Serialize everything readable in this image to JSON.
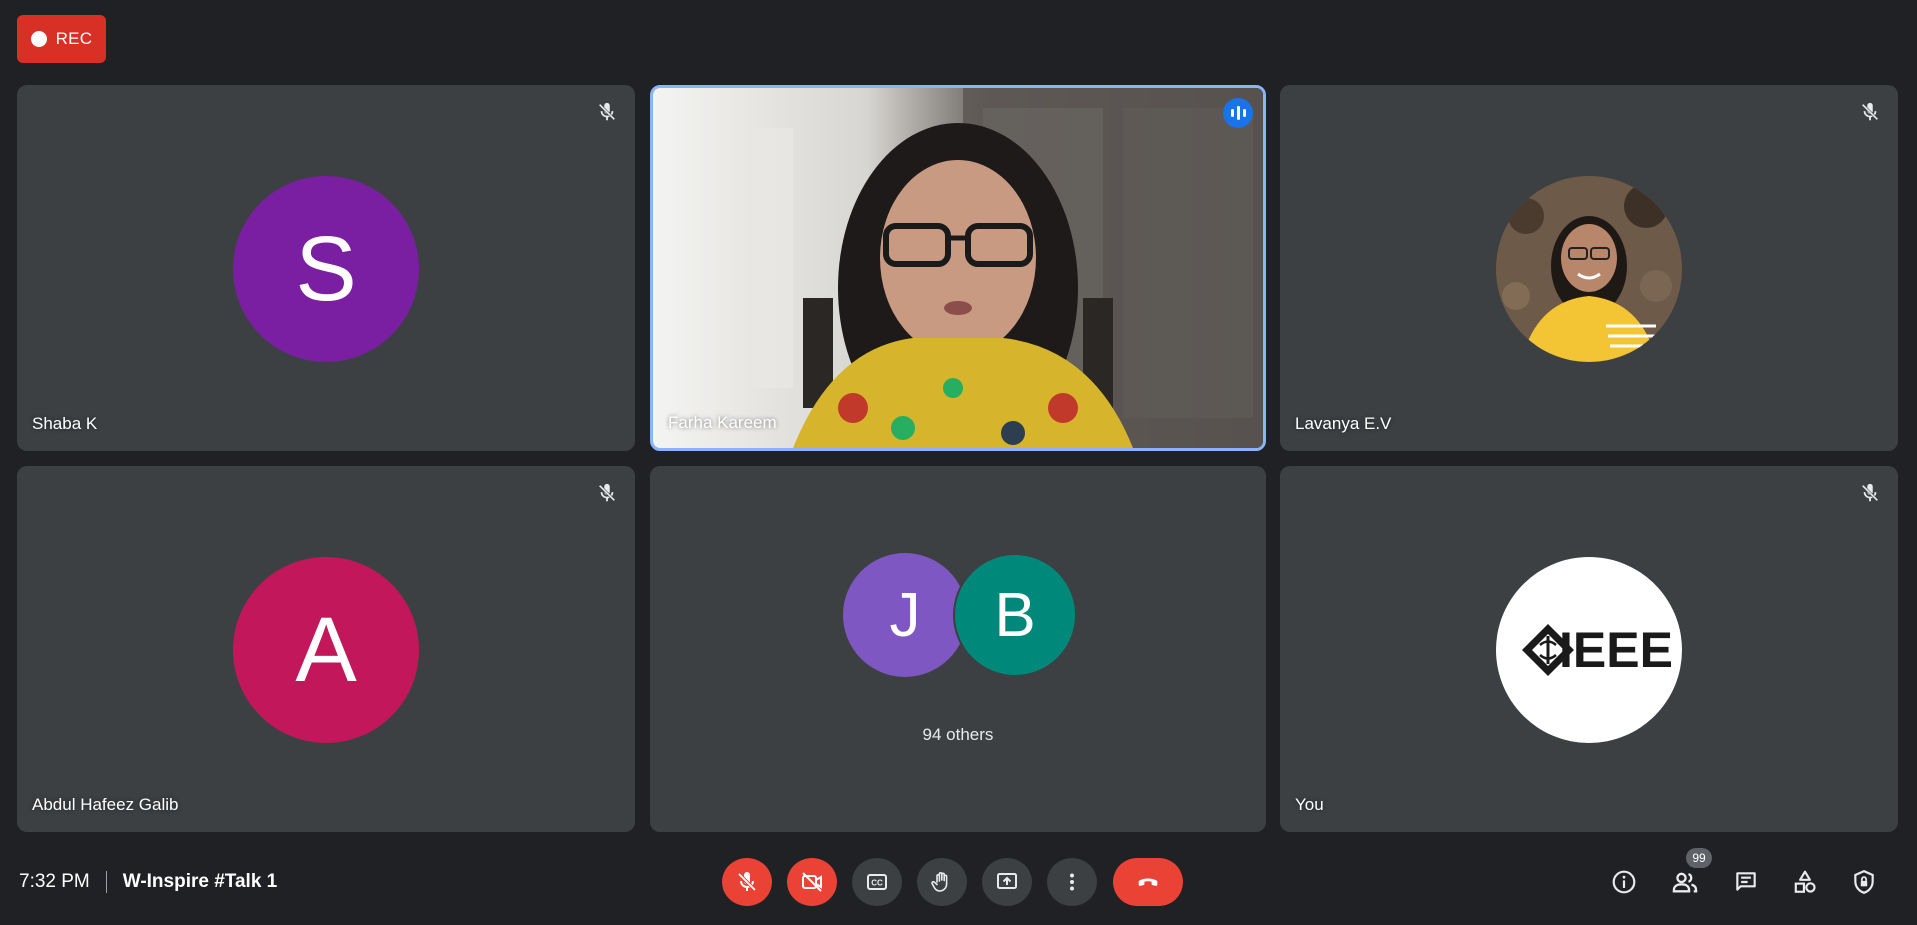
{
  "recording": {
    "label": "REC"
  },
  "tiles": [
    {
      "name": "Shaba K",
      "initial": "S",
      "color": "#7b1fa2",
      "muted": true
    },
    {
      "name": "Farha Kareem",
      "speaking": true
    },
    {
      "name": "Lavanya E.V",
      "muted": true
    },
    {
      "name": "Abdul Hafeez Galib",
      "initial": "A",
      "color": "#c2185b",
      "muted": true
    },
    {
      "group_initials": [
        "J",
        "B"
      ],
      "group_colors": [
        "#7e57c2",
        "#00897b"
      ],
      "others_label": "94 others"
    },
    {
      "name": "You",
      "logo_text": "IEEE",
      "muted": true
    }
  ],
  "bottom_bar": {
    "time": "7:32 PM",
    "meeting_title": "W-Inspire #Talk 1",
    "participants_count": "99",
    "controls": [
      "mic-off",
      "camera-off",
      "captions",
      "raise-hand",
      "present",
      "more-options",
      "end-call"
    ],
    "right_actions": [
      "meeting-info",
      "people",
      "chat",
      "activities",
      "host-controls"
    ]
  },
  "colors": {
    "background": "#202124",
    "tile": "#3c4043",
    "danger": "#ea4335",
    "accent": "#1a73e8",
    "speaking_border": "#8ab4f8"
  }
}
